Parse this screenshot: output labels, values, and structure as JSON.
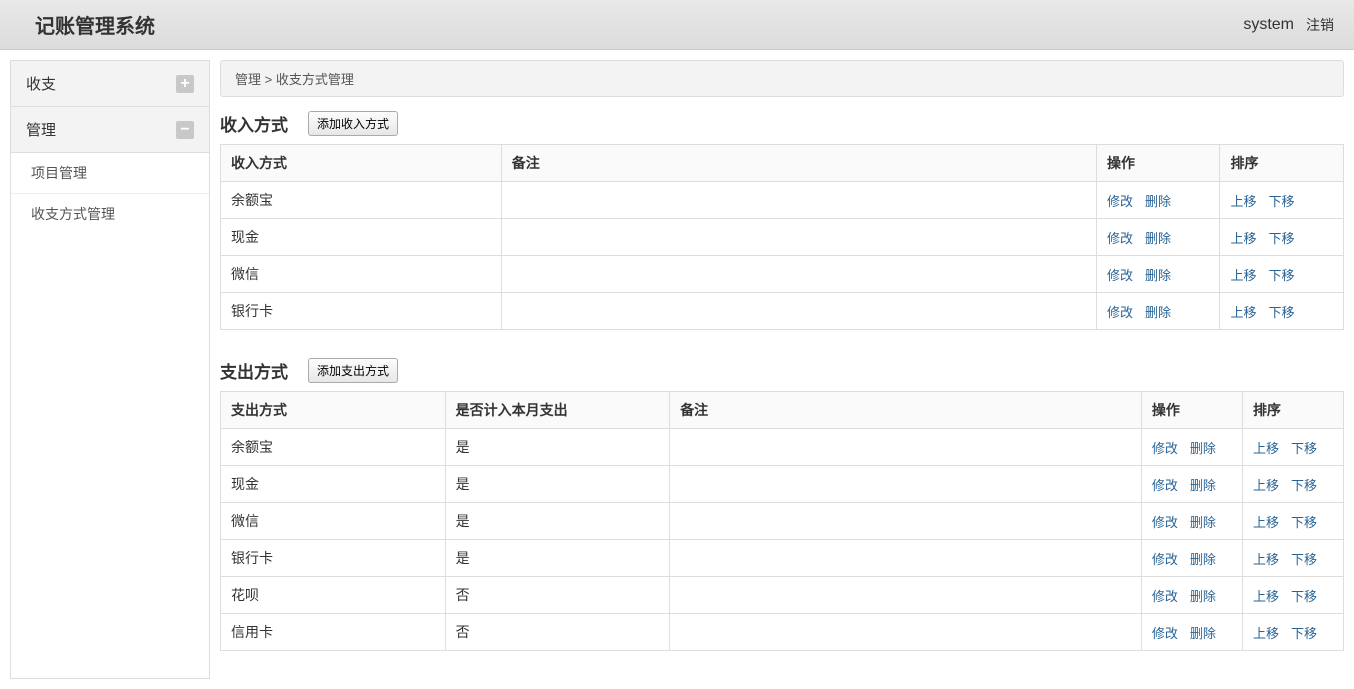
{
  "header": {
    "title": "记账管理系统",
    "user": "system",
    "logout": "注销"
  },
  "sidebar": {
    "groups": [
      {
        "label": "收支",
        "expanded": false,
        "items": []
      },
      {
        "label": "管理",
        "expanded": true,
        "items": [
          {
            "label": "项目管理"
          },
          {
            "label": "收支方式管理"
          }
        ]
      }
    ]
  },
  "breadcrumb": {
    "parts": [
      "管理",
      "收支方式管理"
    ],
    "sep": " > "
  },
  "income": {
    "title": "收入方式",
    "add_label": "添加收入方式",
    "columns": {
      "method": "收入方式",
      "note": "备注",
      "action": "操作",
      "sort": "排序"
    },
    "rows": [
      {
        "method": "余额宝",
        "note": ""
      },
      {
        "method": "现金",
        "note": ""
      },
      {
        "method": "微信",
        "note": ""
      },
      {
        "method": "银行卡",
        "note": ""
      }
    ]
  },
  "expense": {
    "title": "支出方式",
    "add_label": "添加支出方式",
    "columns": {
      "method": "支出方式",
      "counted": "是否计入本月支出",
      "note": "备注",
      "action": "操作",
      "sort": "排序"
    },
    "rows": [
      {
        "method": "余额宝",
        "counted": "是",
        "note": ""
      },
      {
        "method": "现金",
        "counted": "是",
        "note": ""
      },
      {
        "method": "微信",
        "counted": "是",
        "note": ""
      },
      {
        "method": "银行卡",
        "counted": "是",
        "note": ""
      },
      {
        "method": "花呗",
        "counted": "否",
        "note": ""
      },
      {
        "method": "信用卡",
        "counted": "否",
        "note": ""
      }
    ]
  },
  "actions": {
    "edit": "修改",
    "delete": "删除",
    "up": "上移",
    "down": "下移"
  }
}
